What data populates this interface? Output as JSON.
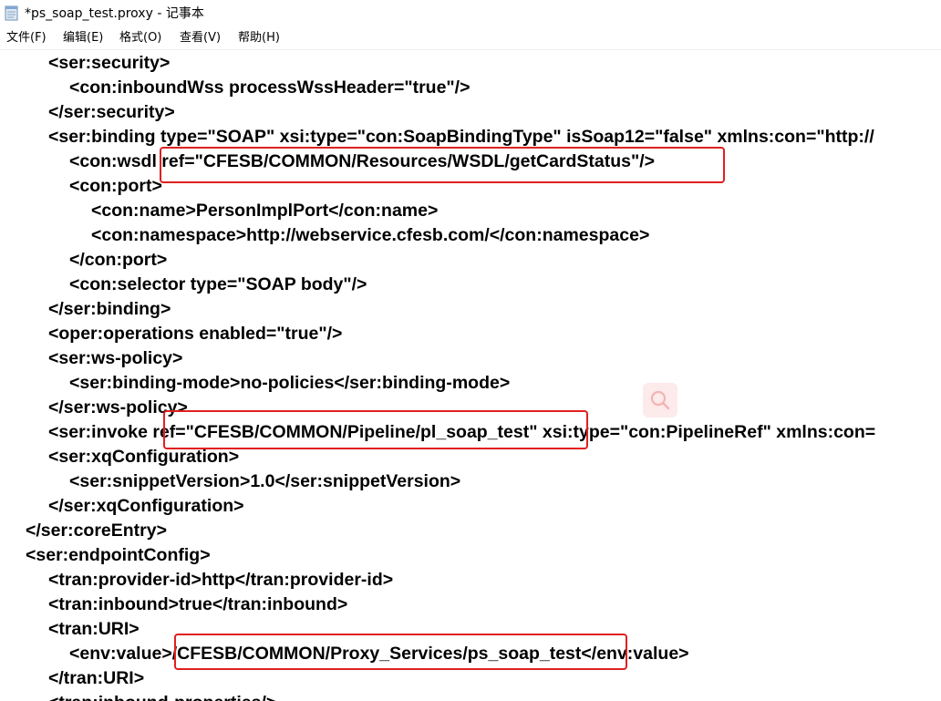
{
  "window": {
    "title": "*ps_soap_test.proxy - 记事本"
  },
  "menu": {
    "items": [
      {
        "label": "文件(F)"
      },
      {
        "label": "编辑(E)"
      },
      {
        "label": "格式(O)"
      },
      {
        "label": "查看(V)"
      },
      {
        "label": "帮助(H)"
      }
    ]
  },
  "editor": {
    "lines": [
      "<ser:security>",
      "<con:inboundWss processWssHeader=\"true\"/>",
      "</ser:security>",
      "<ser:binding type=\"SOAP\" xsi:type=\"con:SoapBindingType\" isSoap12=\"false\" xmlns:con=\"http://",
      "<con:wsdl ref=\"CFESB/COMMON/Resources/WSDL/getCardStatus\"/>",
      "<con:port>",
      "<con:name>PersonImplPort</con:name>",
      "<con:namespace>http://webservice.cfesb.com/</con:namespace>",
      "</con:port>",
      "<con:selector type=\"SOAP body\"/>",
      "</ser:binding>",
      "<oper:operations enabled=\"true\"/>",
      "<ser:ws-policy>",
      "<ser:binding-mode>no-policies</ser:binding-mode>",
      "</ser:ws-policy>",
      "<ser:invoke ref=\"CFESB/COMMON/Pipeline/pl_soap_test\" xsi:type=\"con:PipelineRef\" xmlns:con=",
      "<ser:xqConfiguration>",
      "<ser:snippetVersion>1.0</ser:snippetVersion>",
      "</ser:xqConfiguration>",
      "</ser:coreEntry>",
      "<ser:endpointConfig>",
      "<tran:provider-id>http</tran:provider-id>",
      "<tran:inbound>true</tran:inbound>",
      "<tran:URI>",
      "<env:value>/CFESB/COMMON/Proxy_Services/ps_soap_test</env:value>",
      "</tran:URI>",
      "<tran:inbound-properties/>"
    ]
  },
  "annotations": {
    "color": "#e02020"
  },
  "icons": {
    "title": "notepad-icon",
    "floating": "search-icon"
  }
}
